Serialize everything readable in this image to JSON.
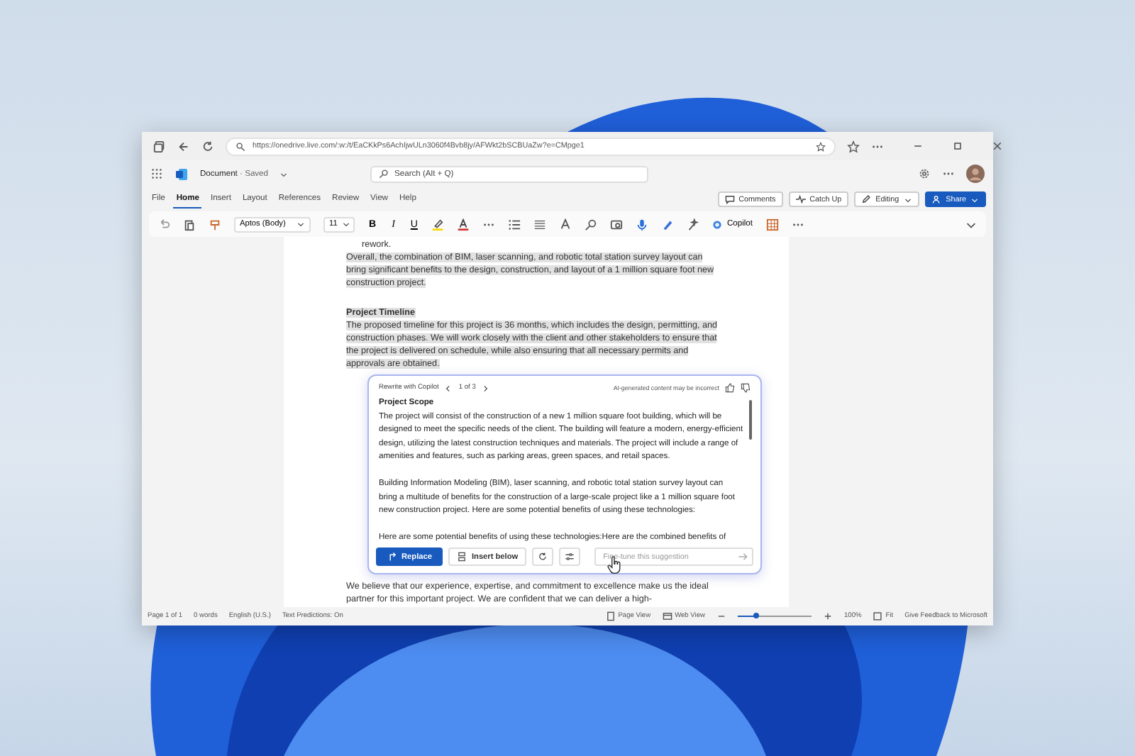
{
  "browser": {
    "url": "https://onedrive.live.com/:w:/t/EaCKkPs6AchIjwULn3060f4Bvb8jy/AFWkt2bSCBUaZw?e=CMpge1"
  },
  "app": {
    "doc_title": "Document",
    "doc_status": "· Saved",
    "search_placeholder": "Search (Alt + Q)"
  },
  "ribbon_tabs": [
    {
      "label": "File",
      "selected": false
    },
    {
      "label": "Home",
      "selected": true
    },
    {
      "label": "Insert",
      "selected": false
    },
    {
      "label": "Layout",
      "selected": false
    },
    {
      "label": "References",
      "selected": false
    },
    {
      "label": "Review",
      "selected": false
    },
    {
      "label": "View",
      "selected": false
    },
    {
      "label": "Help",
      "selected": false
    }
  ],
  "ribbon_actions": {
    "comments": "Comments",
    "catch_up": "Catch Up",
    "editing": "Editing",
    "share": "Share"
  },
  "toolbar": {
    "font": "Aptos (Body)",
    "size": "11",
    "bold": "B",
    "italic": "I",
    "underline": "U",
    "copilot": "Copilot"
  },
  "document": {
    "top_fragment": "rework.",
    "blocks": [
      {
        "kind": "paragraph",
        "text": "Overall, the combination of BIM, laser scanning, and robotic total station survey layout can bring significant benefits to the design, construction, and layout of a 1 million square foot new construction project.",
        "selected": true
      },
      {
        "kind": "heading",
        "text": "Project Timeline",
        "selected": true
      },
      {
        "kind": "paragraph",
        "text": "The proposed timeline for this project is 36 months, which includes the design, permitting, and construction phases. We will work closely with the client and other stakeholders to ensure that the project is delivered on schedule, while also ensuring that all necessary permits and approvals are obtained.",
        "selected": true
      }
    ],
    "bottom_paragraph": "We believe that our experience, expertise, and commitment to excellence make us the ideal partner for this important project. We are confident that we can deliver a high-"
  },
  "copilot": {
    "title": "Rewrite with Copilot",
    "pager": "1 of 3",
    "disclaimer": "AI-generated content may be incorrect",
    "heading": "Project Scope",
    "paragraphs": [
      "The project will consist of the construction of a new 1 million square foot building, which will be designed to meet the specific needs of the client. The building will feature a modern, energy-efficient design, utilizing the latest construction techniques and materials. The project will include a range of amenities and features, such as parking areas, green spaces, and retail spaces.",
      "Building Information Modeling (BIM), laser scanning, and robotic total station survey layout can bring a multitude of benefits for the construction of a large-scale project like a 1 million square foot new construction project. Here are some potential benefits of using these technologies:",
      "Here are some potential benefits of using these technologies:Here are the combined benefits of"
    ],
    "replace": "Replace",
    "insert_below": "Insert below",
    "fine_tune_placeholder": "Fine-tune this suggestion"
  },
  "status_bar": {
    "page": "Page 1 of 1",
    "words": "0 words",
    "language": "English (U.S.)",
    "predictions": "Text Predictions: On",
    "page_view": "Page View",
    "web_view": "Web View",
    "zoom": {
      "level": 0.25
    },
    "zoom_text": "100%",
    "fit": "Fit",
    "feedback": "Give Feedback to Microsoft"
  }
}
